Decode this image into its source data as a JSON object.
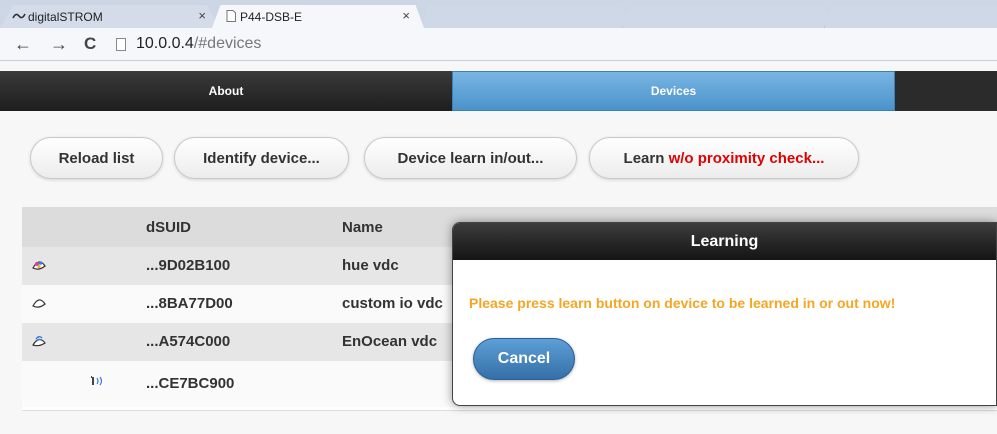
{
  "browser": {
    "tabs": [
      {
        "label": "digitalSTROM",
        "close": "×",
        "icon": "wave-icon"
      },
      {
        "label": "P44-DSB-E",
        "close": "×",
        "icon": "page-icon"
      }
    ],
    "nav": {
      "back": "←",
      "forward": "→",
      "reload": "C"
    },
    "url_host": "10.0.0.4",
    "url_path": "/#devices"
  },
  "appnav": {
    "about": "About",
    "devices": "Devices"
  },
  "toolbar": {
    "reload": "Reload list",
    "identify": "Identify device...",
    "learn": "Device learn in/out...",
    "learn_prefix": "Learn ",
    "learn_warn": "w/o proximity check...",
    "warn_color": "#e00000"
  },
  "table": {
    "headers": {
      "dsuid": "dSUID",
      "name": "Name"
    },
    "rows": [
      {
        "icon": "hue-icon",
        "dsuid": "...9D02B100",
        "name": "hue vdc"
      },
      {
        "icon": "custom-io-icon",
        "dsuid": "...8BA77D00",
        "name": "custom io vdc"
      },
      {
        "icon": "enocean-icon",
        "dsuid": "...A574C000",
        "name": "EnOcean vdc"
      },
      {
        "icon": "sensor-icon",
        "dsuid": "...CE7BC900",
        "name": ""
      }
    ]
  },
  "dialog": {
    "title": "Learning",
    "message": "Please press learn button on device to be learned in or out now!",
    "message_color": "#f5a623",
    "cancel": "Cancel"
  }
}
